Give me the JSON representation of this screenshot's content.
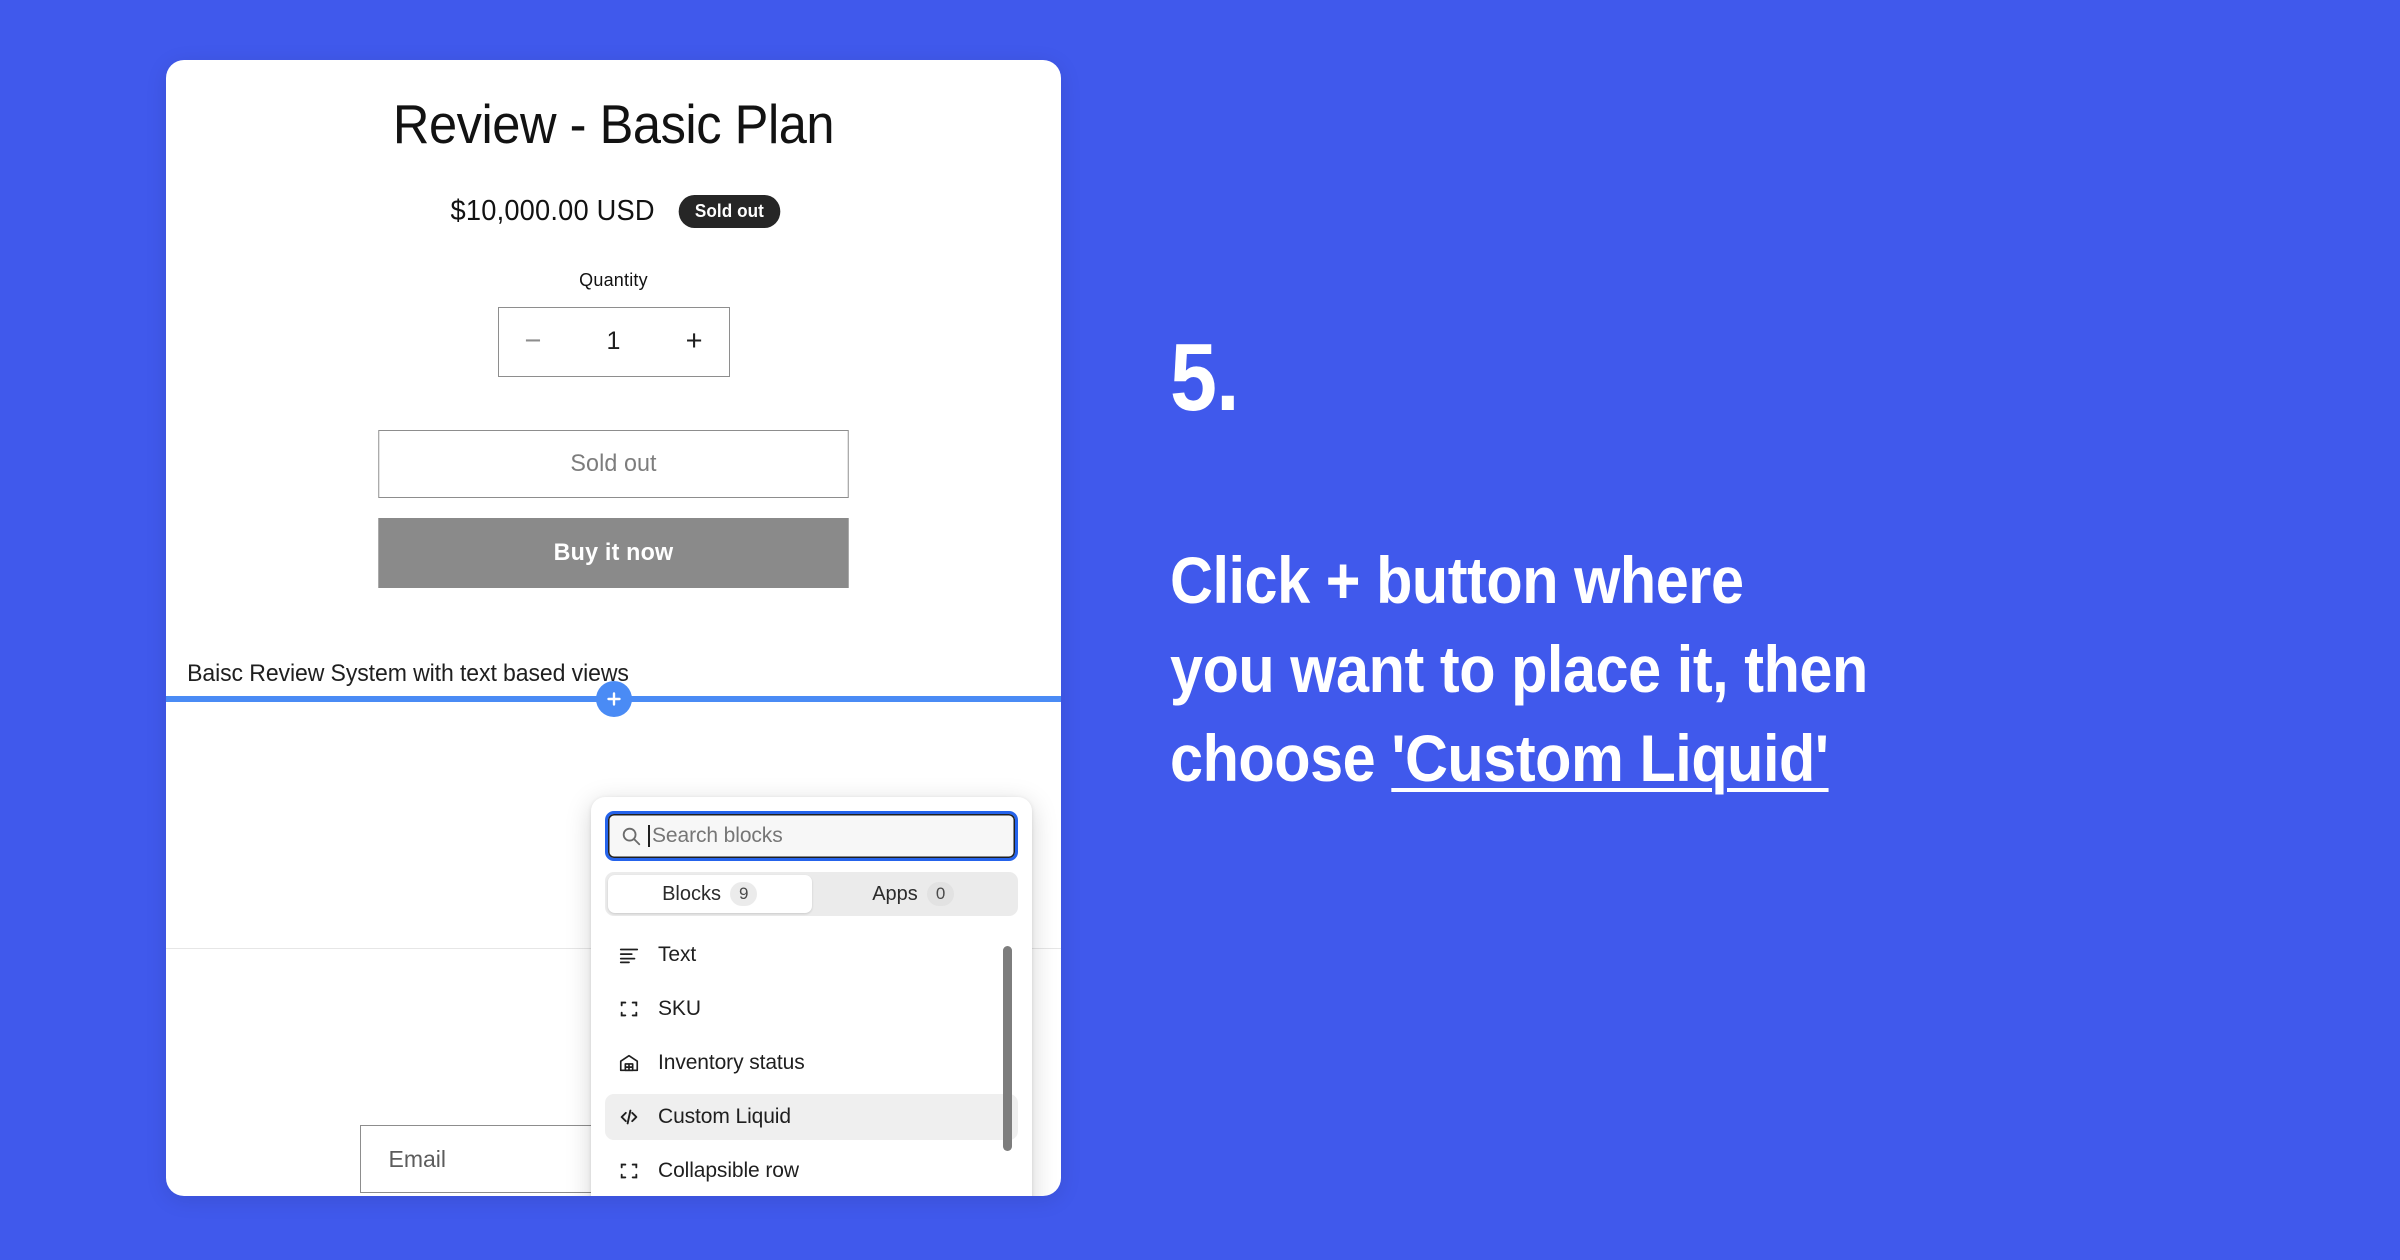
{
  "colors": {
    "background_blue": "#4059EC",
    "insert_line_blue": "#4A8BF5",
    "focus_ring_blue": "#2563EB",
    "sold_out_badge_bg": "#262626",
    "buy_now_button_bg": "#8A8A8A",
    "selected_item_bg": "#EFEFEF",
    "text_white": "#FFFFFF"
  },
  "product": {
    "title": "Review - Basic Plan",
    "price": "$10,000.00 USD",
    "availability_badge": "Sold out",
    "quantity_label": "Quantity",
    "quantity_value": "1",
    "quantity_decrease": "−",
    "quantity_increase": "+",
    "sold_out_button": "Sold out",
    "buy_now_button": "Buy it now",
    "block_caption": "Baisc Review System with text based views",
    "insert_button": "+"
  },
  "newsletter": {
    "email_placeholder": "Email",
    "submit_icon": "arrow-right-icon"
  },
  "block_picker": {
    "search": {
      "placeholder": "Search blocks",
      "value": "",
      "icon": "search-icon"
    },
    "tabs": [
      {
        "label": "Blocks",
        "count": "9",
        "active": true
      },
      {
        "label": "Apps",
        "count": "0",
        "active": false
      }
    ],
    "items": [
      {
        "label": "Text",
        "icon": "text-align-icon",
        "selected": false
      },
      {
        "label": "SKU",
        "icon": "crop-brackets-icon",
        "selected": false
      },
      {
        "label": "Inventory status",
        "icon": "warehouse-icon",
        "selected": false
      },
      {
        "label": "Custom Liquid",
        "icon": "code-brackets-icon",
        "selected": true
      },
      {
        "label": "Collapsible row",
        "icon": "crop-brackets-icon",
        "selected": false
      }
    ]
  },
  "instructions": {
    "step_number": "5.",
    "line1": "Click  + button where",
    "line2": "you want to place it, then",
    "line3_prefix": "choose ",
    "line3_emphasis": "'Custom Liquid'"
  }
}
